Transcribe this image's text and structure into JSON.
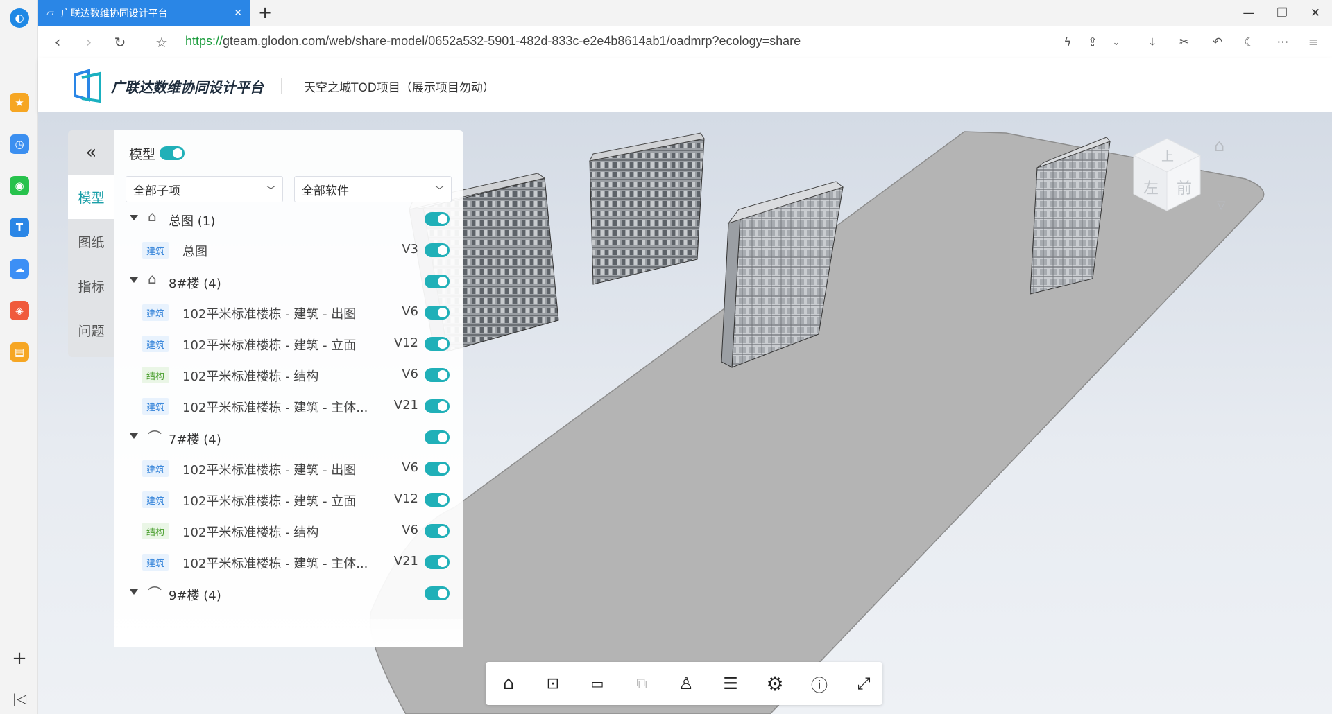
{
  "browser": {
    "tab_title": "广联达数维协同设计平台",
    "new_tab": "+",
    "url_scheme": "https://",
    "url_rest": "gteam.glodon.com/web/share-model/0652a532-5901-482d-833c-e2e4b8614ab1/oadmrp?ecology=share",
    "window": {
      "minimize": "—",
      "restore": "❐",
      "close": "✕"
    }
  },
  "header": {
    "logo_text": "广联达数维协同设计平台",
    "project_name": "天空之城TOD项目（展示项目勿动）"
  },
  "panel": {
    "tabs": [
      {
        "label": "模型"
      },
      {
        "label": "图纸"
      },
      {
        "label": "指标"
      },
      {
        "label": "问题"
      }
    ],
    "collapse": "«",
    "title": "模型",
    "filter_subitem": "全部子项",
    "filter_software": "全部软件",
    "groups": [
      {
        "label": "总图 (1)",
        "icon": "house-icon",
        "items": [
          {
            "tag": "建筑",
            "type": "arch",
            "label": "总图",
            "version": "V3"
          }
        ]
      },
      {
        "label": "8#楼 (4)",
        "icon": "house-icon",
        "items": [
          {
            "tag": "建筑",
            "type": "arch",
            "label": "102平米标准楼栋 - 建筑 - 出图",
            "version": "V6"
          },
          {
            "tag": "建筑",
            "type": "arch",
            "label": "102平米标准楼栋 - 建筑 - 立面",
            "version": "V12"
          },
          {
            "tag": "结构",
            "type": "struct",
            "label": "102平米标准楼栋 - 结构",
            "version": "V6"
          },
          {
            "tag": "建筑",
            "type": "arch",
            "label": "102平米标准楼栋 - 建筑 - 主体...",
            "version": "V21"
          }
        ]
      },
      {
        "label": "7#楼 (4)",
        "icon": "paperclip-icon",
        "items": [
          {
            "tag": "建筑",
            "type": "arch",
            "label": "102平米标准楼栋 - 建筑 - 出图",
            "version": "V6"
          },
          {
            "tag": "建筑",
            "type": "arch",
            "label": "102平米标准楼栋 - 建筑 - 立面",
            "version": "V12"
          },
          {
            "tag": "结构",
            "type": "struct",
            "label": "102平米标准楼栋 - 结构",
            "version": "V6"
          },
          {
            "tag": "建筑",
            "type": "arch",
            "label": "102平米标准楼栋 - 建筑 - 主体...",
            "version": "V21"
          }
        ]
      },
      {
        "label": "9#楼 (4)",
        "icon": "paperclip-icon",
        "items": []
      }
    ]
  },
  "viewcube": {
    "top": "上",
    "left": "左",
    "front": "前"
  },
  "colors": {
    "accent": "#20b0b8",
    "tab_blue": "#2a86e6"
  }
}
